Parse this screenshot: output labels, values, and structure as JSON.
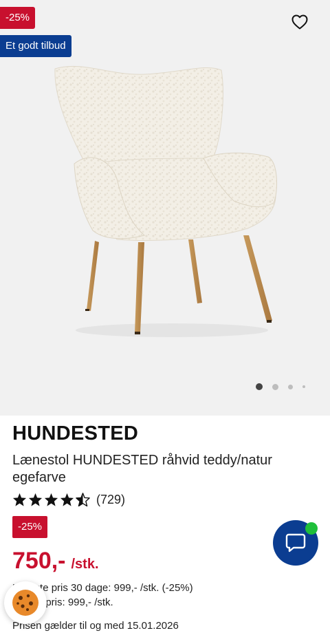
{
  "gallery": {
    "discount_badge": "-25%",
    "offer_badge": "Et godt tilbud",
    "favorite_icon": "heart-outline-icon",
    "carousel": {
      "count": 4,
      "active_index": 0
    }
  },
  "product": {
    "brand": "HUNDESTED",
    "name": "Lænestol HUNDESTED råhvid teddy/natur egefarve",
    "rating": {
      "stars": 4.5,
      "max": 5,
      "count": "(729)"
    }
  },
  "pricing": {
    "discount_badge": "-25%",
    "price": "750,-",
    "unit": "/stk.",
    "lowest_price": "Laveste pris 30 dage: 999,- /stk. (-25%)",
    "normal_price": "Normalpris: 999,- /stk.",
    "valid_until": "Prisen gælder til og med 15.01.2026"
  },
  "colors": {
    "sale_red": "#c8102e",
    "brand_blue": "#0b3d91",
    "online_green": "#1fbf3a"
  },
  "floating": {
    "cookie_icon": "cookie-icon",
    "chat_icon": "chat-bubble-icon"
  }
}
